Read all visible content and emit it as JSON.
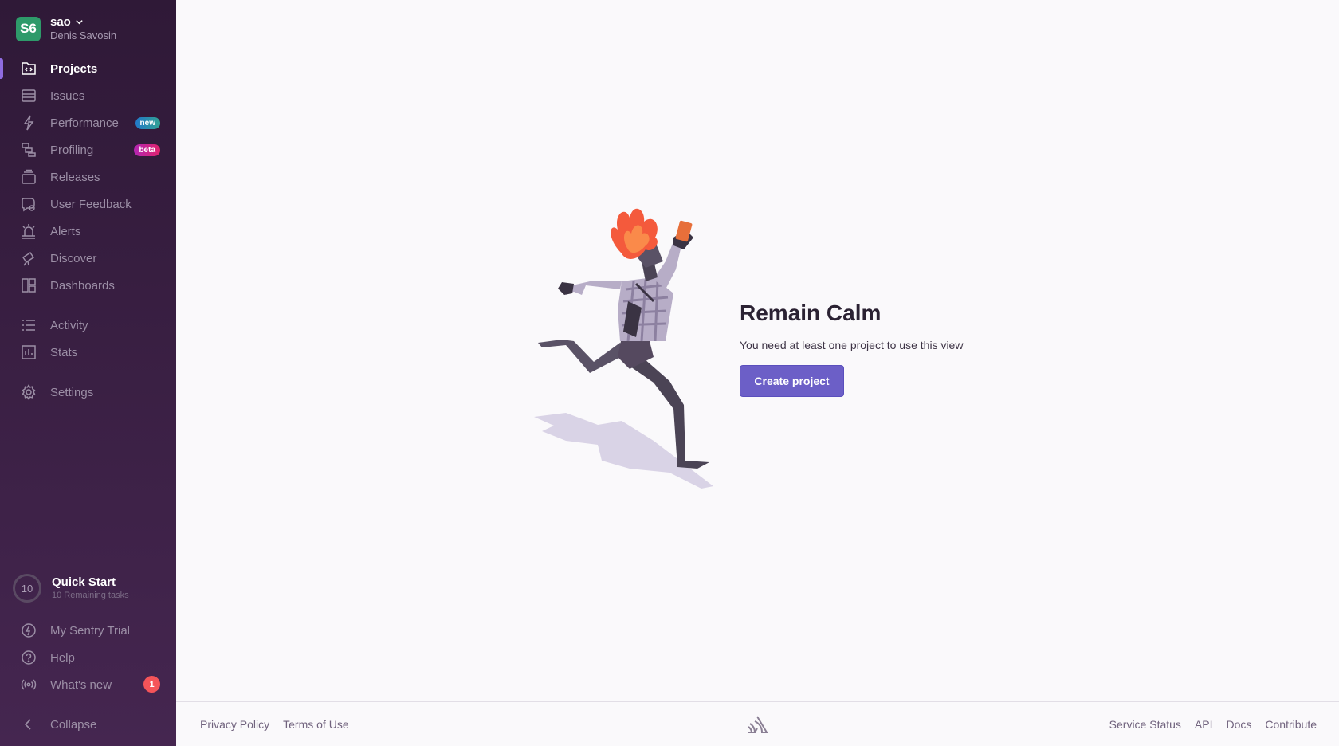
{
  "org": {
    "avatar_initials": "S6",
    "name": "sao",
    "user": "Denis Savosin",
    "avatar_color": "#2e9a6a"
  },
  "nav": {
    "primary": [
      {
        "label": "Projects",
        "icon": "projects-icon",
        "active": true
      },
      {
        "label": "Issues",
        "icon": "issues-icon"
      },
      {
        "label": "Performance",
        "icon": "performance-icon",
        "badge": "new"
      },
      {
        "label": "Profiling",
        "icon": "profiling-icon",
        "badge": "beta"
      },
      {
        "label": "Releases",
        "icon": "releases-icon"
      },
      {
        "label": "User Feedback",
        "icon": "user-feedback-icon"
      },
      {
        "label": "Alerts",
        "icon": "alerts-icon"
      },
      {
        "label": "Discover",
        "icon": "discover-icon"
      },
      {
        "label": "Dashboards",
        "icon": "dashboards-icon"
      }
    ],
    "secondary": [
      {
        "label": "Activity",
        "icon": "activity-icon"
      },
      {
        "label": "Stats",
        "icon": "stats-icon"
      }
    ],
    "settings": {
      "label": "Settings",
      "icon": "settings-icon"
    }
  },
  "quickstart": {
    "count": "10",
    "title": "Quick Start",
    "subtitle": "10 Remaining tasks"
  },
  "bottom_nav": [
    {
      "label": "My Sentry Trial",
      "icon": "sentry-trial-icon"
    },
    {
      "label": "Help",
      "icon": "help-icon"
    },
    {
      "label": "What's new",
      "icon": "broadcast-icon",
      "count": "1"
    }
  ],
  "collapse": {
    "label": "Collapse",
    "icon": "chevron-left-icon"
  },
  "empty_state": {
    "title": "Remain Calm",
    "description": "You need at least one project to use this view",
    "button": "Create project"
  },
  "footer": {
    "left_links": [
      "Privacy Policy",
      "Terms of Use"
    ],
    "right_links": [
      "Service Status",
      "API",
      "Docs",
      "Contribute"
    ]
  },
  "colors": {
    "sidebar_top": "#2f1937",
    "sidebar_bottom": "#452650",
    "accent": "#6c5fc7",
    "active_indicator": "#8f6ce0",
    "badge_count": "#f55459"
  }
}
